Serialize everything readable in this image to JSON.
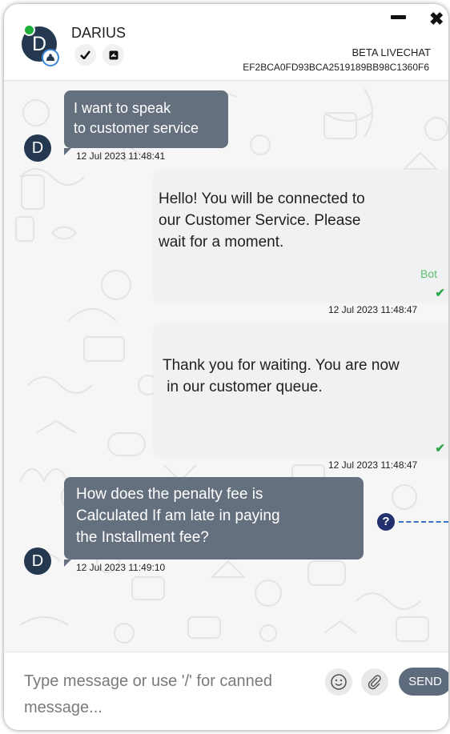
{
  "header": {
    "contact_initial": "D",
    "contact_name": "DARIUS",
    "title": "BETA LIVECHAT",
    "session_id": "EF2BCA0FD93BCA2519189BB98C1360F6",
    "minimize_icon": "minimize-icon",
    "close_icon": "close-icon",
    "close_glyph": "✖"
  },
  "messages": [
    {
      "direction": "incoming",
      "avatar_initial": "D",
      "lines": [
        "I want to speak",
        "to customer service"
      ],
      "timestamp": "12 Jul 2023 11:48:41"
    },
    {
      "direction": "outgoing",
      "lines": [
        "Hello! You will be connected to",
        "our Customer Service. Please",
        "wait for a moment."
      ],
      "sender": "Bot",
      "timestamp": "12 Jul 2023 11:48:47"
    },
    {
      "direction": "outgoing",
      "lines": [
        "Thank you for waiting. You are now",
        " in our customer queue."
      ],
      "timestamp": "12 Jul 2023 11:48:47"
    },
    {
      "direction": "incoming",
      "avatar_initial": "D",
      "lines": [
        "How does the penalty fee is",
        "Calculated If am late in paying",
        "the Installment fee?"
      ],
      "timestamp": "12 Jul 2023 11:49:10"
    }
  ],
  "help_glyph": "?",
  "composer": {
    "placeholder_line1": "Type message or use '/' for canned",
    "placeholder_line2": "message...",
    "send_label": "SEND"
  },
  "colors": {
    "incoming_bubble": "#65707f",
    "outgoing_bubble": "#f0f1f2",
    "avatar": "#24384f",
    "online": "#1fae3b",
    "send_button": "#5e6b7d"
  }
}
